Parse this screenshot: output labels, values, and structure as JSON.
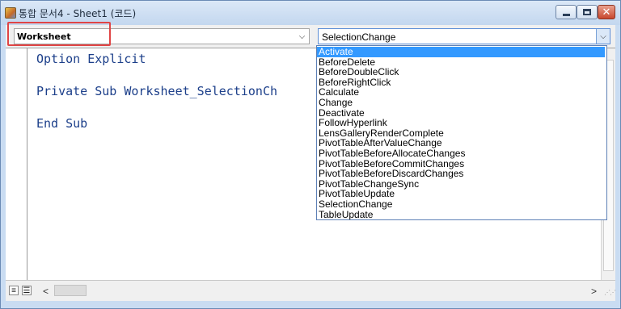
{
  "window": {
    "title": "통합 문서4 - Sheet1 (코드)"
  },
  "toolbar": {
    "object_combo_value": "Worksheet",
    "procedure_combo_value": "SelectionChange",
    "arrow_glyph": "⌵"
  },
  "editor": {
    "lines": [
      "Option Explicit",
      "Private Sub Worksheet_SelectionCh",
      "End Sub"
    ]
  },
  "dropdown": {
    "selected_index": 0,
    "items": [
      "Activate",
      "BeforeDelete",
      "BeforeDoubleClick",
      "BeforeRightClick",
      "Calculate",
      "Change",
      "Deactivate",
      "FollowHyperlink",
      "LensGalleryRenderComplete",
      "PivotTableAfterValueChange",
      "PivotTableBeforeAllocateChanges",
      "PivotTableBeforeCommitChanges",
      "PivotTableBeforeDiscardChanges",
      "PivotTableChangeSync",
      "PivotTableUpdate",
      "SelectionChange",
      "TableUpdate"
    ]
  },
  "statusbar": {
    "left_arrow": "<",
    "right_arrow": ">"
  },
  "colors": {
    "selection": "#3399ff",
    "code_text": "#1c3f8a",
    "annotation_box": "#e04545"
  },
  "icons": {
    "title": "vba-module-icon",
    "minimize": "minimize-icon",
    "maximize": "maximize-icon",
    "close": "close-icon"
  }
}
